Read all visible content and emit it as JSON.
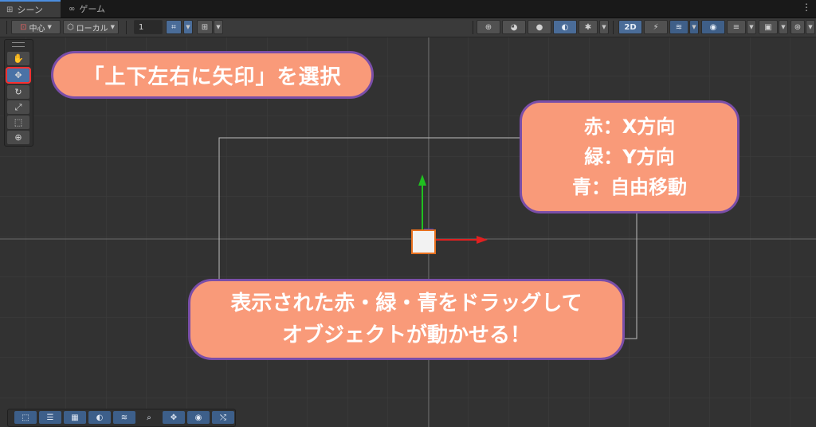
{
  "tabs": [
    {
      "label": "シーン",
      "icon": "grid-icon"
    },
    {
      "label": "ゲーム",
      "icon": "gamepad-icon"
    }
  ],
  "toolbar": {
    "pivot_label": "中心",
    "space_label": "ローカル",
    "grid_value": "1",
    "mode_2d_label": "2D"
  },
  "callouts": {
    "select_tool": "「上下左右に矢印」を選択",
    "axis_lines": [
      "赤：X方向",
      "緑：Y方向",
      "青：自由移動"
    ],
    "drag_hint": [
      "表示された赤・緑・青をドラッグして",
      "オブジェクトが動かせる！"
    ]
  },
  "colors": {
    "callout_fill": "#f99a79",
    "callout_border": "#7a4ea8",
    "active_blue": "#4a72a6",
    "x_axis": "#e02020",
    "y_axis": "#20c020",
    "highlight": "#ff3030"
  }
}
